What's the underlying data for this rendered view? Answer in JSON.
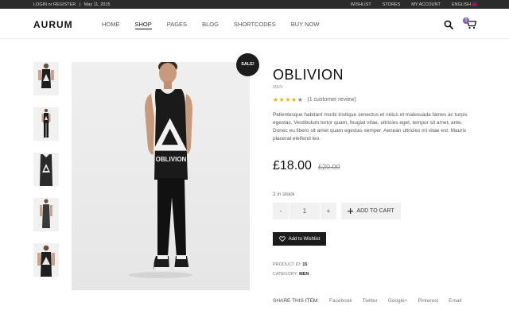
{
  "topbar": {
    "login": "LOGIN or REGISTER",
    "separator": "|",
    "date": "May 11, 2015",
    "links": [
      "WISHLIST",
      "STORES",
      "MY ACCOUNT",
      "ENGLISH"
    ]
  },
  "header": {
    "logo": "AURUM",
    "nav": [
      "HOME",
      "SHOP",
      "PAGES",
      "BLOG",
      "SHORTCODES",
      "BUY NOW"
    ],
    "active_nav": "SHOP",
    "cart_count": "0",
    "search_icon": "search-icon",
    "cart_icon": "cart-icon"
  },
  "product": {
    "sale_badge": "SALE!",
    "title": "OBLIVION",
    "category": "MEN",
    "rating": 4,
    "rating_max": 5,
    "reviews": "(1 customer review)",
    "description": "Pellentesque habitant morbi tristique senectus et netus et malesuada fames ac turpis egestas. Vestibulum tortor quam, feugiat vitae, ultricies eget, tempor sit amet, ante. Donec eu libero sit amet quam egestas semper. Aenean ultricies mi vitae est. Mauris placerat eleifend leo.",
    "price": "£18.00",
    "old_price": "£20.00",
    "stock": "2 in stock",
    "qty_minus": "-",
    "qty_value": "1",
    "qty_plus": "+",
    "add_to_cart": "ADD TO CART",
    "wishlist": "Add to Wishlist",
    "product_id_label": "PRODUCT ID:",
    "product_id": "15",
    "category_label": "CATEGORY:",
    "category_value": "MEN",
    "shirt_text": "OBLIVION"
  },
  "share": {
    "label": "SHARE THIS ITEM:",
    "links": [
      "Facebook",
      "Twitter",
      "Google+",
      "Pinterest",
      "Email"
    ]
  },
  "colors": {
    "accent": "#7b5ea7",
    "star": "#f3b300",
    "dark": "#1c1c1c"
  }
}
